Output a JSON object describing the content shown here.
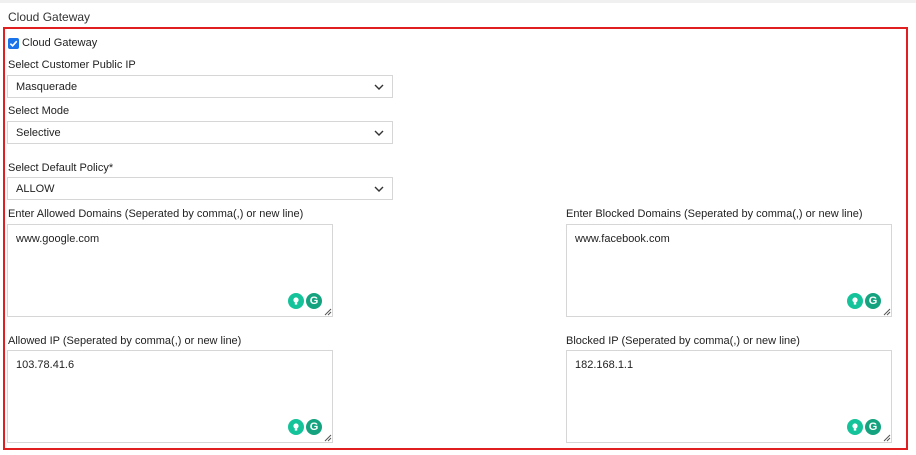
{
  "section_title": "Cloud Gateway",
  "cloud_gateway_checkbox": {
    "label": "Cloud Gateway",
    "checked": true
  },
  "customer_public_ip": {
    "label": "Select Customer Public IP",
    "value": "Masquerade"
  },
  "mode": {
    "label": "Select Mode",
    "value": "Selective"
  },
  "default_policy": {
    "label": "Select Default Policy*",
    "value": "ALLOW"
  },
  "allowed_domains": {
    "label": "Enter Allowed Domains (Seperated by comma(,) or new line)",
    "value": "www.google.com"
  },
  "blocked_domains": {
    "label": "Enter Blocked Domains (Seperated by comma(,) or new line)",
    "value": "www.facebook.com"
  },
  "allowed_ip": {
    "label": "Allowed IP (Seperated by comma(,) or new line)",
    "value": "103.78.41.6"
  },
  "blocked_ip": {
    "label": "Blocked IP (Seperated by comma(,) or new line)",
    "value": "182.168.1.1"
  },
  "colors": {
    "frame": "#e02020",
    "checkbox": "#1a73e8",
    "grammarly": "#15c39a"
  },
  "icons": {
    "select_arrow": "chevron-down-icon",
    "grammarly": "grammarly-icon",
    "bulb": "lightbulb-icon",
    "resize": "resize-handle-icon"
  }
}
